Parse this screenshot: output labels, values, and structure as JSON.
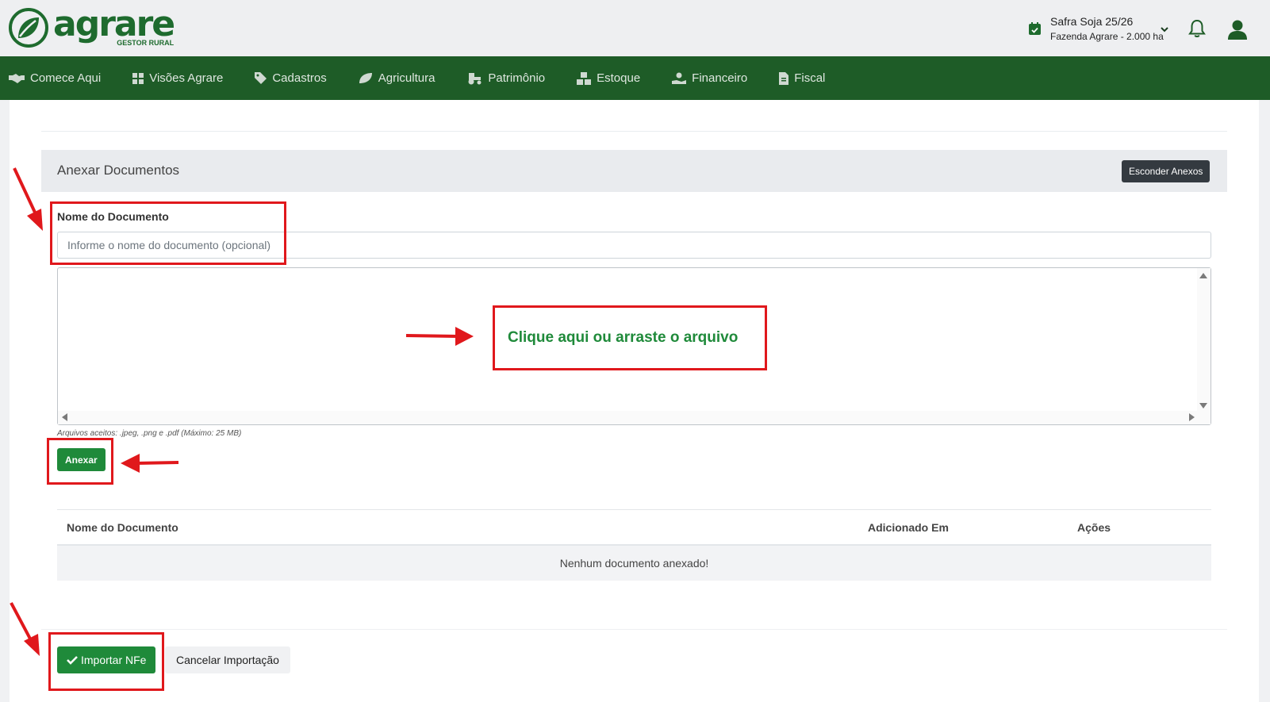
{
  "header": {
    "logo_text": "agrare",
    "logo_subtitle": "GESTOR RURAL",
    "season_name": "Safra Soja 25/26",
    "farm_name": "Fazenda Agrare - 2.000 ha",
    "icons": [
      "calendar-check-icon",
      "chevron-down-icon",
      "bell-icon",
      "user-icon"
    ]
  },
  "nav": {
    "items": [
      {
        "label": "Comece Aqui",
        "icon": "handshake-icon"
      },
      {
        "label": "Visões Agrare",
        "icon": "grid-icon"
      },
      {
        "label": "Cadastros",
        "icon": "tag-icon"
      },
      {
        "label": "Agricultura",
        "icon": "leaf-icon"
      },
      {
        "label": "Patrimônio",
        "icon": "tractor-icon"
      },
      {
        "label": "Estoque",
        "icon": "boxes-icon"
      },
      {
        "label": "Financeiro",
        "icon": "hand-coin-icon"
      },
      {
        "label": "Fiscal",
        "icon": "file-icon"
      }
    ]
  },
  "attachments": {
    "title": "Anexar Documentos",
    "hide_button": "Esconder Anexos",
    "name_label": "Nome do Documento",
    "name_placeholder": "Informe o nome do documento (opcional)",
    "dropzone_text": "Clique aqui ou arraste o arquivo",
    "accepted_hint": "Arquivos aceitos: .jpeg, .png e .pdf (Máximo: 25 MB)",
    "attach_button": "Anexar",
    "table": {
      "columns": [
        "Nome do Documento",
        "Adicionado Em",
        "Ações"
      ],
      "empty_message": "Nenhum documento anexado!"
    }
  },
  "footer": {
    "import_button": "Importar NFe",
    "cancel_button": "Cancelar Importação"
  },
  "colors": {
    "brand_green": "#1e5c27",
    "button_green": "#1f8a3a",
    "annotation_red": "#e0181c",
    "dark_button": "#343a40"
  }
}
